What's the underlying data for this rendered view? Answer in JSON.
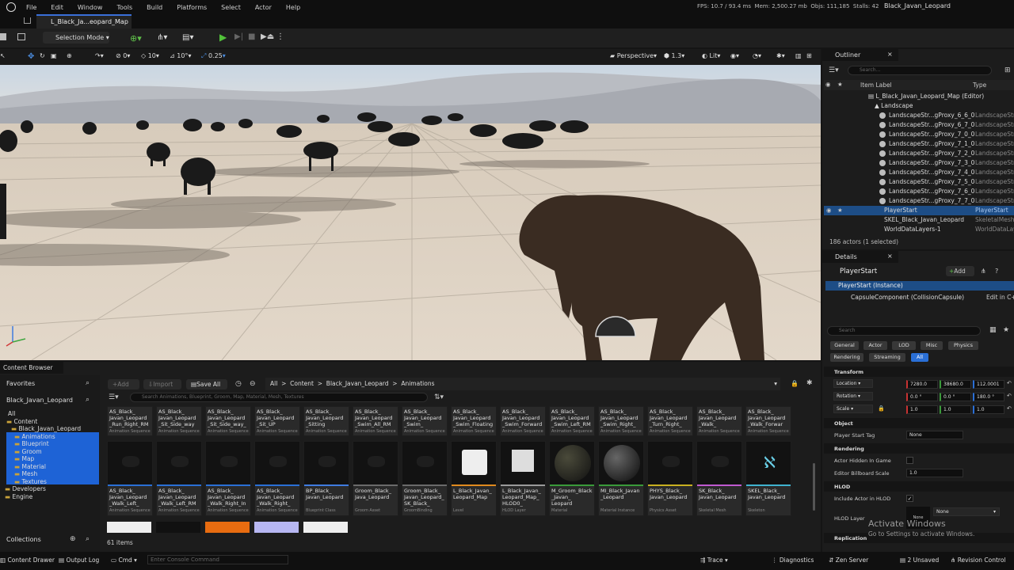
{
  "menu": [
    "File",
    "Edit",
    "Window",
    "Tools",
    "Build",
    "Platforms",
    "Select",
    "Actor",
    "Help"
  ],
  "stats": {
    "fps_label": "FPS:",
    "fps": "10.7",
    "ms": "93.4 ms",
    "mem_label": "Mem:",
    "mem": "2,500.27 mb",
    "objs_label": "Objs:",
    "objs": "111,185",
    "stalls_label": "Stalls:",
    "stalls": "42"
  },
  "project_name": "Black_Javan_Leopard",
  "map_tab": "L_Black_Ja...eopard_Map",
  "toolbar": {
    "mode": "Selection Mode"
  },
  "viewport_toolbar": {
    "snap_rot": "0",
    "grid": "10",
    "angle": "10°",
    "scale": "0.25",
    "perspective": "Perspective",
    "fov": "1.3",
    "lit": "Lit"
  },
  "outliner": {
    "title": "Outliner",
    "search_placeholder": "Search...",
    "col_label": "Item Label",
    "col_type": "Type",
    "root": "L_Black_Javan_Leopard_Map (Editor)",
    "landscape": "Landscape",
    "rows": [
      {
        "name": "LandscapeStr...gProxy_6_6_0",
        "type": "LandscapeStr"
      },
      {
        "name": "LandscapeStr...gProxy_6_7_0",
        "type": "LandscapeStr"
      },
      {
        "name": "LandscapeStr...gProxy_7_0_0",
        "type": "LandscapeStr"
      },
      {
        "name": "LandscapeStr...gProxy_7_1_0",
        "type": "LandscapeStr"
      },
      {
        "name": "LandscapeStr...gProxy_7_2_0",
        "type": "LandscapeStr"
      },
      {
        "name": "LandscapeStr...gProxy_7_3_0",
        "type": "LandscapeStr"
      },
      {
        "name": "LandscapeStr...gProxy_7_4_0",
        "type": "LandscapeStr"
      },
      {
        "name": "LandscapeStr...gProxy_7_5_0",
        "type": "LandscapeStr"
      },
      {
        "name": "LandscapeStr...gProxy_7_6_0",
        "type": "LandscapeStr"
      },
      {
        "name": "LandscapeStr...gProxy_7_7_0",
        "type": "LandscapeStr"
      }
    ],
    "selected": {
      "name": "PlayerStart",
      "type": "PlayerStart"
    },
    "skel": {
      "name": "SKEL_Black_Javan_Leopard",
      "type": "SkeletalMesh"
    },
    "world": {
      "name": "WorldDataLayers-1",
      "type": "WorldDataLay"
    },
    "footer": "186 actors (1 selected)"
  },
  "details": {
    "title": "Details",
    "object": "PlayerStart",
    "add": "Add",
    "instance": "PlayerStart (Instance)",
    "component": "CapsuleComponent (CollisionCapsule)",
    "edit_link": "Edit in C+",
    "search_placeholder": "Search",
    "filters": [
      "General",
      "Actor",
      "LOD",
      "Misc",
      "Physics",
      "Rendering",
      "Streaming",
      "All"
    ],
    "sections": {
      "transform": "Transform",
      "object": "Object",
      "rendering": "Rendering",
      "hlod": "HLOD",
      "replication": "Replication"
    },
    "location": {
      "label": "Location",
      "x": "7280.0",
      "y": "38680.0",
      "z": "112.0001"
    },
    "rotation": {
      "label": "Rotation",
      "x": "0.0 °",
      "y": "0.0 °",
      "z": "180.0 °"
    },
    "scale": {
      "label": "Scale",
      "x": "1.0",
      "y": "1.0",
      "z": "1.0"
    },
    "player_start_tag": {
      "label": "Player Start Tag",
      "value": "None"
    },
    "actor_hidden": "Actor Hidden In Game",
    "billboard": {
      "label": "Editor Billboard Scale",
      "value": "1.0"
    },
    "include_hlod": "Include Actor in HLOD",
    "hlod_layer": {
      "label": "HLOD Layer",
      "value": "None",
      "thumb": "None"
    }
  },
  "watermark": {
    "line1": "Activate Windows",
    "line2": "Go to Settings to activate Windows."
  },
  "content_browser": {
    "title": "Content Browser",
    "add": "Add",
    "import": "Import",
    "save_all": "Save All",
    "breadcrumb": [
      "All",
      "Content",
      "Black_Javan_Leopard",
      "Animations"
    ],
    "search_placeholder": "Search Animations, Blueprint, Groom, Map, Material, Mesh, Textures",
    "favorites": "Favorites",
    "project_root": "Black_Javan_Leopard",
    "tree": [
      "All",
      "Content",
      "Black_Javan_Leopard",
      "Animations",
      "Blueprint",
      "Groom",
      "Map",
      "Material",
      "Mesh",
      "Textures",
      "Developers",
      "Engine"
    ],
    "collections": "Collections",
    "count": "61 items",
    "row1": [
      {
        "name": "AS_Black_ Javan_Leopard _Run_Right_RM",
        "type": "Animation Sequence"
      },
      {
        "name": "AS_Black_ Javan_Leopard _Sit_Side_way",
        "type": "Animation Sequence"
      },
      {
        "name": "AS_Black_ Javan_Leopard _Sit_Side_way_",
        "type": "Animation Sequence"
      },
      {
        "name": "AS_Black_ Javan_Leopard _Sit_UP",
        "type": "Animation Sequence"
      },
      {
        "name": "AS_Black_ Javan_Leopard _Sitting",
        "type": "Animation Sequence"
      },
      {
        "name": "AS_Black_ Javan_Leopard _Swim_All_RM",
        "type": "Animation Sequence"
      },
      {
        "name": "AS_Black_ Javan_Leopard _Swim_",
        "type": "Animation Sequence"
      },
      {
        "name": "AS_Black_ Javan_Leopard _Swim_Floating",
        "type": "Animation Sequence"
      },
      {
        "name": "AS_Black_ Javan_Leopard _Swim_Forward",
        "type": "Animation Sequence"
      },
      {
        "name": "AS_Black_ Javan_Leopard _Swim_Left_RM",
        "type": "Animation Sequence"
      },
      {
        "name": "AS_Black_ Javan_Leopard _Swim_Right_",
        "type": "Animation Sequence"
      },
      {
        "name": "AS_Black_ Javan_Leopard _Turn_Right_",
        "type": "Animation Sequence"
      },
      {
        "name": "AS_Black_ Javan_Leopard _Walk_",
        "type": "Animation Sequence"
      },
      {
        "name": "AS_Black_ Javan_Leopard _Walk_Forwar",
        "type": "Animation Sequence"
      }
    ],
    "row2": [
      {
        "name": "AS_Black_ Javan_Leopard _Walk_Left_",
        "type": "Animation Sequence",
        "color": "#2a6fd6"
      },
      {
        "name": "AS_Black_ Javan_Leopard _Walk_Left_RM",
        "type": "Animation Sequence",
        "color": "#2a6fd6"
      },
      {
        "name": "AS_Black_ Javan_Leopard _Walk_Right_In",
        "type": "Animation Sequence",
        "color": "#2a6fd6"
      },
      {
        "name": "AS_Black_ Javan_Leopard _Walk_Right_",
        "type": "Animation Sequence",
        "color": "#2a6fd6"
      },
      {
        "name": "BP_Black_ Javan_Leopard",
        "type": "Blueprint Class",
        "color": "#3f7be0"
      },
      {
        "name": "Groom_Black_ Java_Leopard",
        "type": "Groom Asset",
        "color": "#6a6a6a"
      },
      {
        "name": "Groom_Black_ Javan_Leopard_ SK_Black_",
        "type": "GroomBinding",
        "color": "#6a6a6a"
      },
      {
        "name": "L_Black_Javan_ Leopard_Map",
        "type": "Level",
        "color": "#e08a1e"
      },
      {
        "name": "L_Black_Javan_ Leopard_Map_ HLOD0_",
        "type": "HLOD Layer",
        "color": "#9a9a9a"
      },
      {
        "name": "M_Groom_Black _Javan_ Leopard",
        "type": "Material",
        "color": "#3a9a3a"
      },
      {
        "name": "MI_Black_Javan _Leopard",
        "type": "Material Instance",
        "color": "#3a9a3a"
      },
      {
        "name": "PHYS_Black_ Javan_Leopard",
        "type": "Physics Asset",
        "color": "#c8b020"
      },
      {
        "name": "SK_Black_ Javan_Leopard",
        "type": "Skeletal Mesh",
        "color": "#c05ad0"
      },
      {
        "name": "SKEL_Black_ Javan_Leopard",
        "type": "Skeleton",
        "color": "#3fb3d0"
      }
    ]
  },
  "statusbar": {
    "content_drawer": "Content Drawer",
    "output_log": "Output Log",
    "cmd": "Cmd",
    "console_placeholder": "Enter Console Command",
    "trace": "Trace",
    "diagnostics": "Diagnostics",
    "zen": "Zen Server",
    "unsaved": "2 Unsaved",
    "revision": "Revision Control"
  }
}
